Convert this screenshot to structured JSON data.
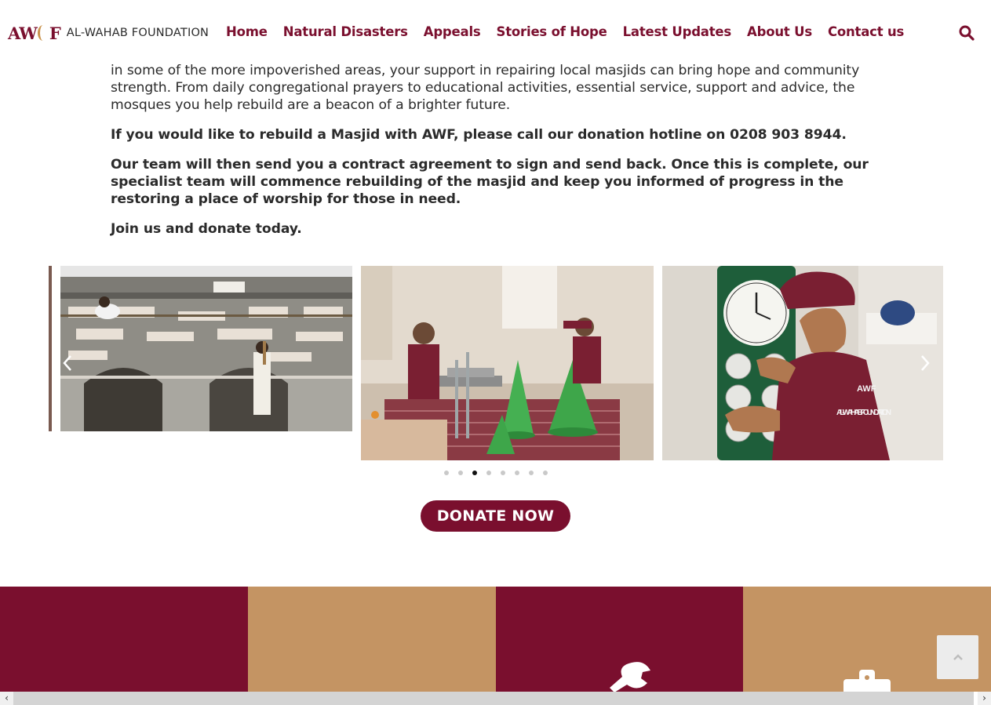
{
  "brand": {
    "logo_mark": "AWF",
    "logo_text": "AL-WAHAB FOUNDATION",
    "color_primary": "#7a0f2e",
    "color_secondary": "#c49463"
  },
  "nav": {
    "items": [
      {
        "label": "Home"
      },
      {
        "label": "Natural Disasters"
      },
      {
        "label": "Appeals"
      },
      {
        "label": "Stories of Hope"
      },
      {
        "label": "Latest Updates"
      },
      {
        "label": "About Us"
      },
      {
        "label": "Contact us"
      }
    ],
    "search_icon": "search-icon"
  },
  "content": {
    "paragraph_1": "in some of the more impoverished areas, your support in repairing local masjids can bring hope and community strength. From daily congregational prayers to educational activities, essential service, support and advice, the mosques you help rebuild are a beacon of a brighter future.",
    "paragraph_2": "If you would like to rebuild a Masjid with AWF, please call our donation hotline on 0208 903 8944.",
    "paragraph_3": "Our team will then send you a contract agreement to sign and send back. Once this is complete, our specialist team will commence rebuilding of the masjid and keep you informed of progress in the restoring a place of worship for those in need.",
    "paragraph_4": "Join us and donate today."
  },
  "carousel": {
    "prev_icon": "chevron-left-icon",
    "next_icon": "chevron-right-icon",
    "dot_count": 8,
    "active_dot": 3,
    "slide_2_logo": "AWF",
    "slide_2_shirt": "AL-WAHAB FOUNDATION"
  },
  "donate_button": {
    "label": "DONATE NOW"
  },
  "blocks": [
    {
      "color": "maroon",
      "icon": ""
    },
    {
      "color": "tan",
      "icon": ""
    },
    {
      "color": "maroon",
      "icon": "wrench-icon"
    },
    {
      "color": "tan",
      "icon": "briefcase-icon"
    }
  ],
  "scroll_top_icon": "chevron-up-icon",
  "hscroll": {
    "left": "‹",
    "right": "›"
  }
}
